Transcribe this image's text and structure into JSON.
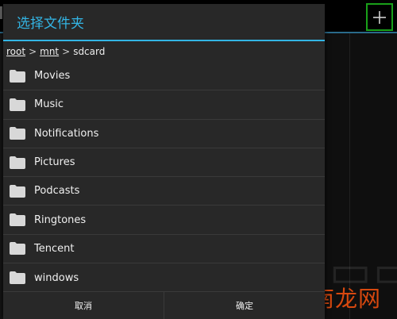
{
  "dialog": {
    "title": "选择文件夹",
    "breadcrumb": {
      "segments": [
        "root",
        "mnt",
        "sdcard"
      ],
      "separator": ">"
    },
    "folders": [
      {
        "name": "Movies",
        "icon": "folder-icon"
      },
      {
        "name": "Music",
        "icon": "folder-icon"
      },
      {
        "name": "Notifications",
        "icon": "folder-icon"
      },
      {
        "name": "Pictures",
        "icon": "folder-icon"
      },
      {
        "name": "Podcasts",
        "icon": "folder-icon"
      },
      {
        "name": "Ringtones",
        "icon": "folder-icon"
      },
      {
        "name": "Tencent",
        "icon": "folder-icon"
      },
      {
        "name": "windows",
        "icon": "folder-icon"
      }
    ],
    "buttons": {
      "cancel_label": "取消",
      "ok_label": "确定"
    }
  },
  "background": {
    "add_icon": "plus-icon"
  },
  "watermark": {
    "text": "云南龙网"
  },
  "colors": {
    "accent": "#33b5e5",
    "dialog_bg": "#282828",
    "highlight_border": "#19a019",
    "watermark": "#d6480f"
  }
}
